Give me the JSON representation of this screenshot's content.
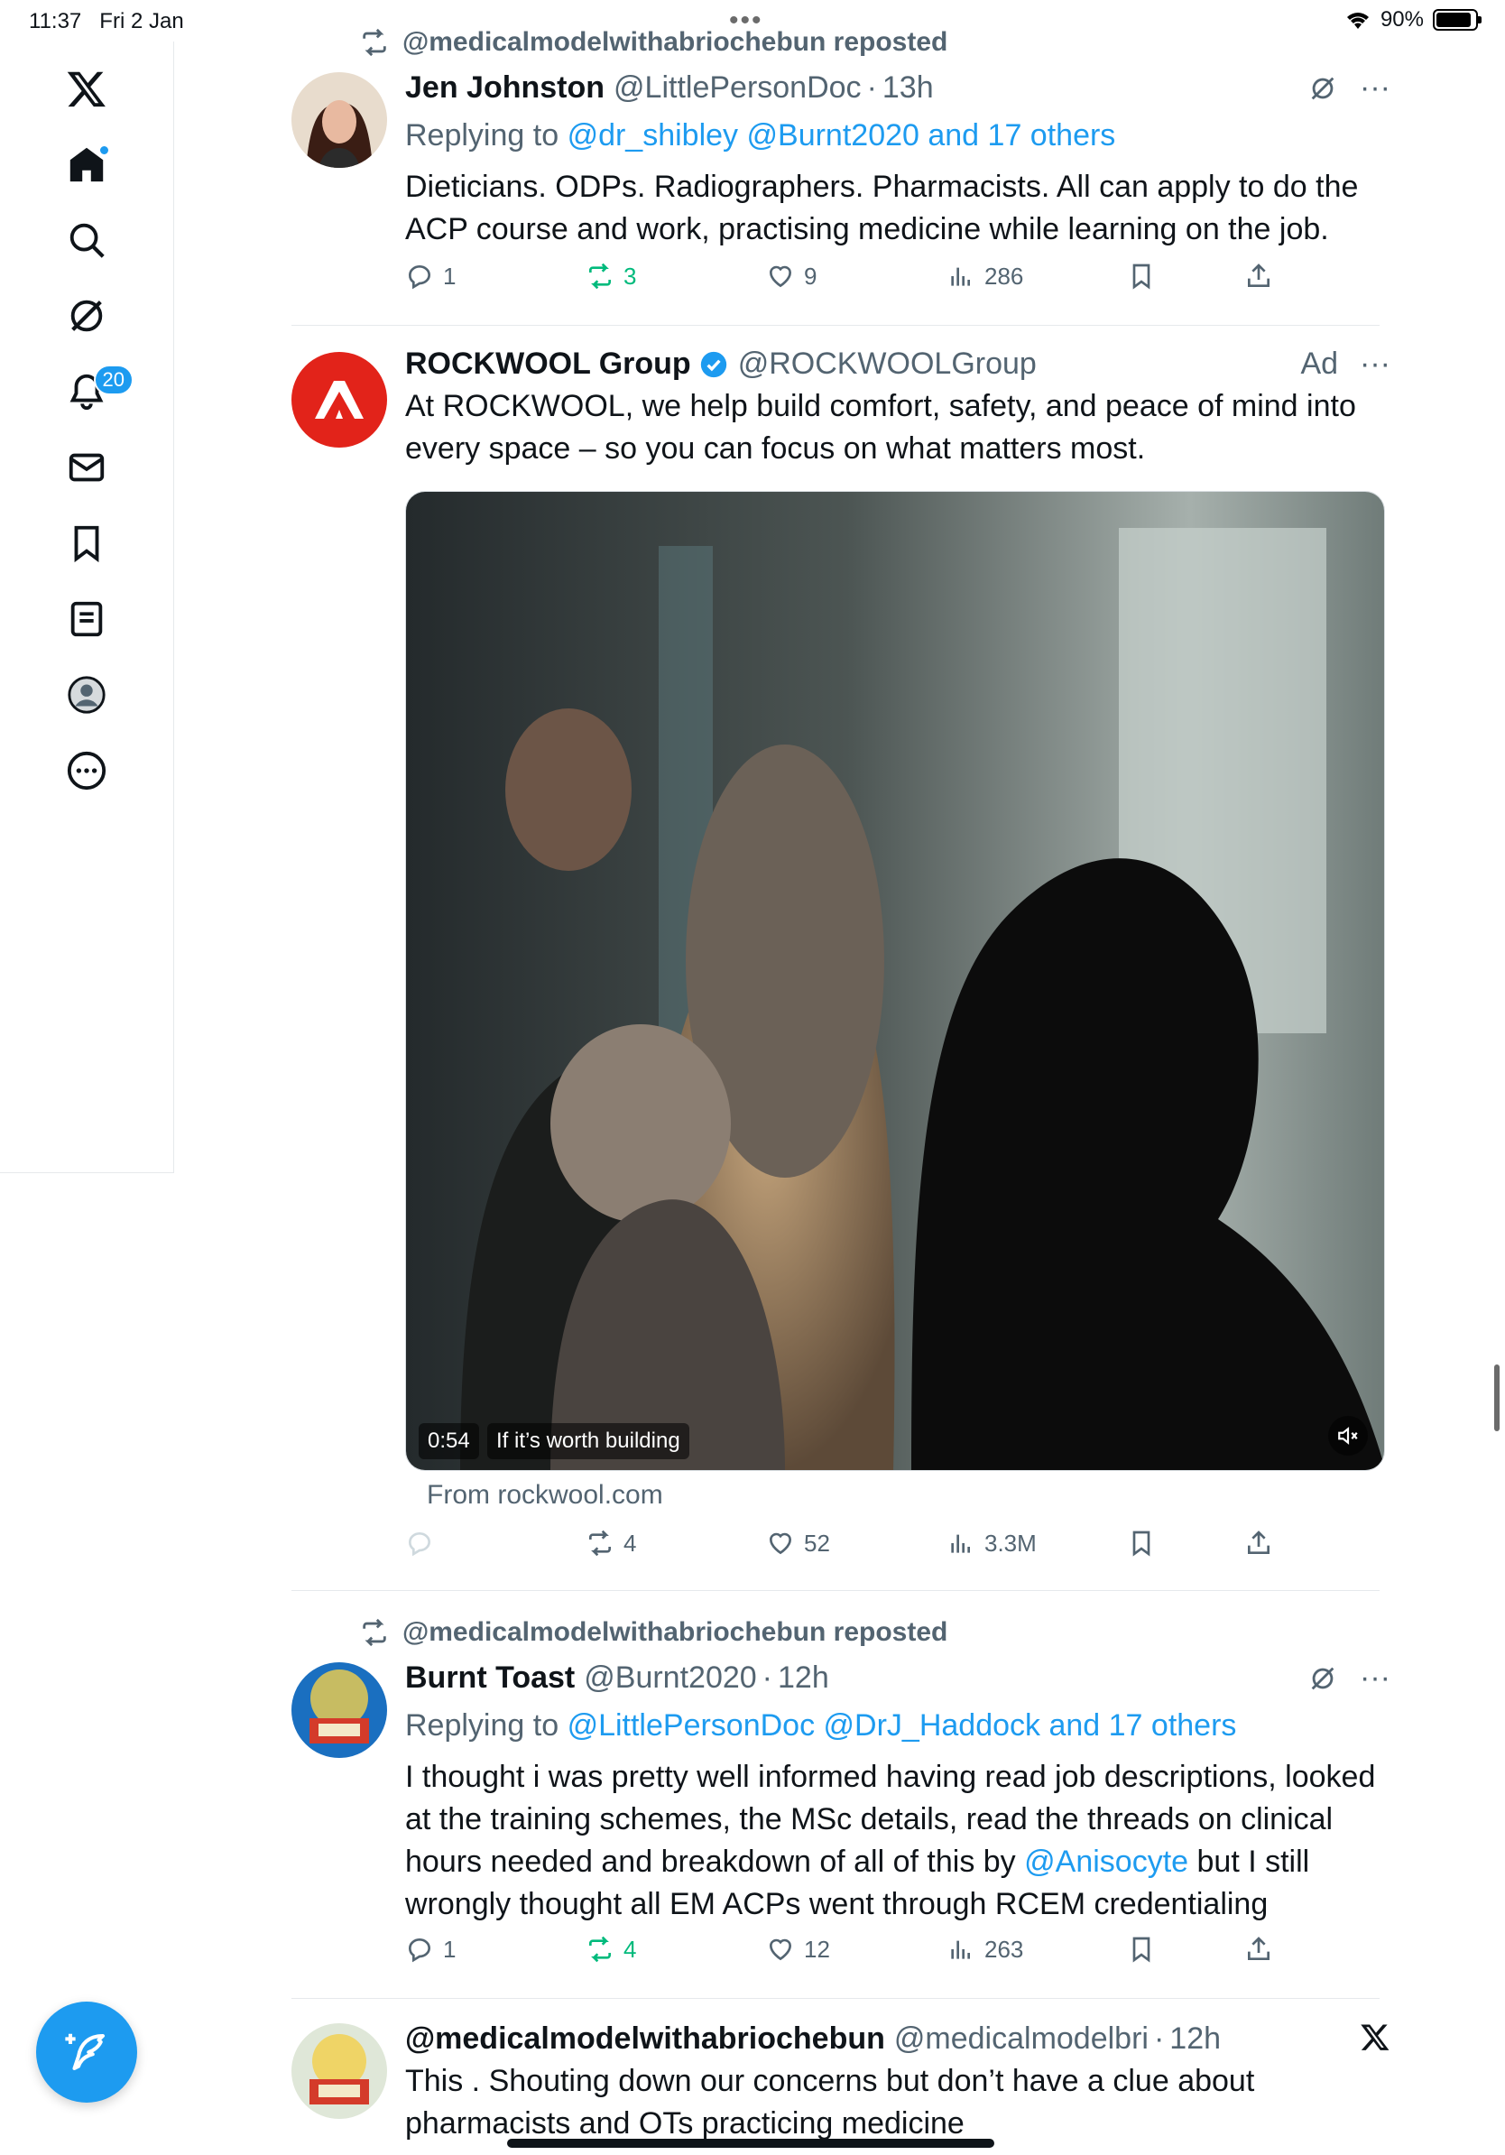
{
  "status_bar": {
    "time": "11:37",
    "date": "Fri 2 Jan",
    "battery": "90%",
    "battery_level": 0.9
  },
  "sidebar": {
    "icons": [
      "x-logo-icon",
      "home-icon",
      "search-icon",
      "grok-icon",
      "notifications-icon",
      "messages-icon",
      "bookmarks-icon",
      "lists-icon",
      "profile-icon",
      "more-icon"
    ],
    "notification_count": "20"
  },
  "tweets": [
    {
      "repost_label": "@medicalmodelwithabriochebun reposted",
      "name": "Jen Johnston",
      "handle": "@LittlePersonDoc",
      "time": "13h",
      "replying_prefix": "Replying to",
      "replying_to": "@dr_shibley @Burnt2020 and 17 others",
      "text": "Dieticians. ODPs. Radiographers. Pharmacists. All can apply to do the ACP course and work, practising medicine while learning on the job.",
      "replies": "1",
      "reposts": "3",
      "likes": "9",
      "views": "286"
    },
    {
      "name": "ROCKWOOL Group",
      "handle": "@ROCKWOOLGroup",
      "ad_label": "Ad",
      "text": "At ROCKWOOL, we help build comfort, safety, and peace of mind into every space – so you can focus on what matters most.",
      "video_duration": "0:54",
      "video_title": "If it’s worth building",
      "source": "From rockwool.com",
      "replies": "",
      "reposts": "4",
      "likes": "52",
      "views": "3.3M"
    },
    {
      "repost_label": "@medicalmodelwithabriochebun reposted",
      "name": "Burnt Toast",
      "handle": "@Burnt2020",
      "time": "12h",
      "replying_prefix": "Replying to",
      "replying_to": "@LittlePersonDoc @DrJ_Haddock and 17 others",
      "text_before": "I thought i was pretty well informed having read job descriptions, looked at the training schemes, the MSc details, read the threads on clinical hours needed and breakdown of all of this by ",
      "mention": "@Anisocyte",
      "text_after": " but I still wrongly thought all EM ACPs went through RCEM credentialing",
      "replies": "1",
      "reposts": "4",
      "likes": "12",
      "views": "263"
    },
    {
      "name": "@medicalmodelwithabriochebun",
      "handle": "@medicalmodelbri",
      "time": "12h",
      "text": "This . Shouting down our concerns but don’t have a clue about pharmacists and OTs practicing medicine"
    }
  ],
  "colors": {
    "accent": "#1d9bf0",
    "repost_green": "#00ba7c",
    "muted": "#536471",
    "rockwool_red": "#e2231a"
  }
}
